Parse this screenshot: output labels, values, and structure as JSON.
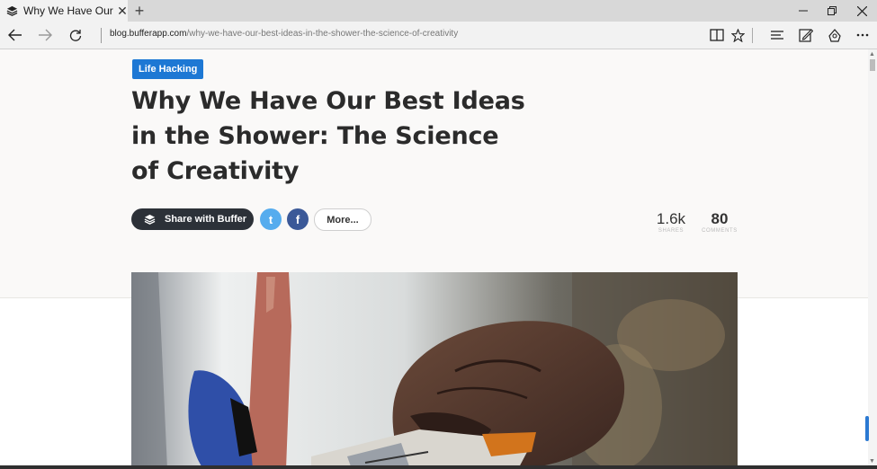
{
  "browser": {
    "tab_title": "Why We Have Our Best",
    "tab_close": "✕",
    "new_tab": "+",
    "url_host": "blog.bufferapp.com",
    "url_path": "/why-we-have-our-best-ideas-in-the-shower-the-science-of-creativity",
    "window_controls": [
      "minimize-icon",
      "restore-icon",
      "close-icon"
    ],
    "toolbar_icons": [
      "reading-view-icon",
      "favorite-star-icon",
      "hub-icon",
      "web-note-icon",
      "share-icon",
      "more-icon"
    ]
  },
  "article": {
    "category": "Life Hacking",
    "title": "Why We Have Our Best Ideas in the Shower: The Science of Creativity",
    "share_button": "Share with Buffer",
    "more_button": "More...",
    "twitter_glyph": "t",
    "facebook_glyph": "f",
    "shares_count": "1.6k",
    "shares_label": "SHARES",
    "comments_count": "80",
    "comments_label": "COMMENTS"
  },
  "colors": {
    "accent": "#1d78d4",
    "share_button_bg": "#2c3138",
    "twitter": "#55acee",
    "facebook": "#3b5998"
  }
}
